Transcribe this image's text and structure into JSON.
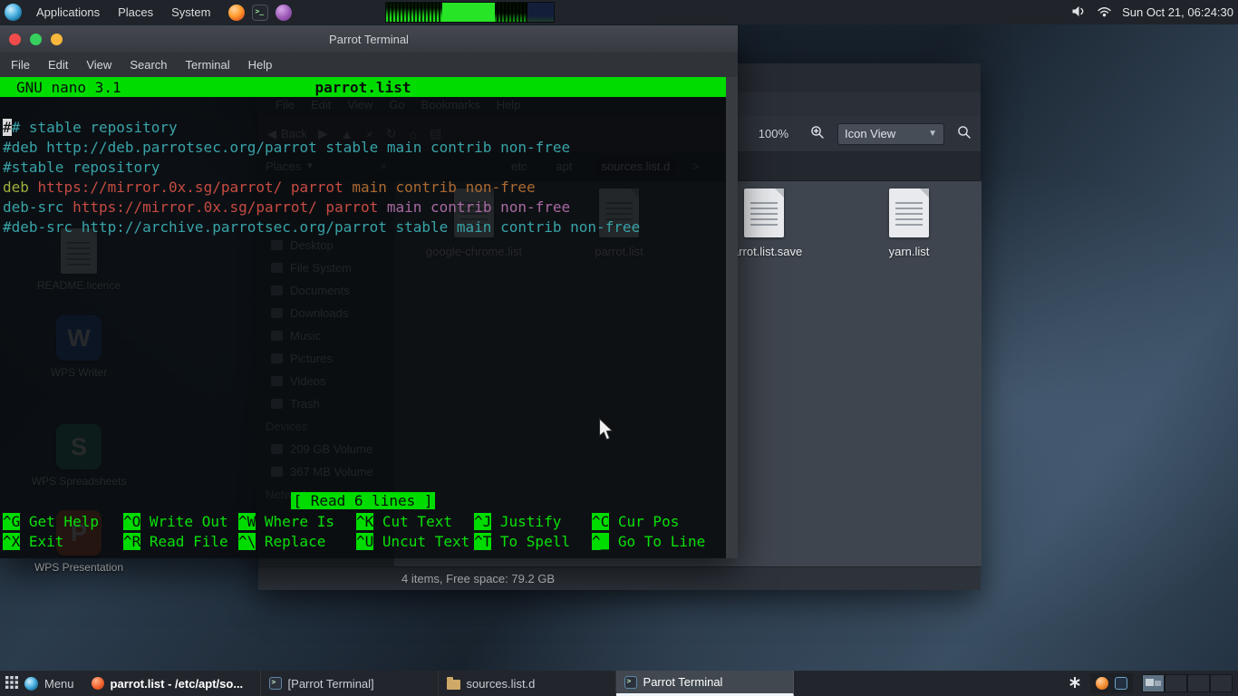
{
  "panel": {
    "menus": [
      "Applications",
      "Places",
      "System"
    ],
    "launchers": [
      "firefox-icon",
      "terminal-icon",
      "package-icon"
    ],
    "status_icons": [
      "volume-icon",
      "network-icon"
    ],
    "clock": "Sun Oct 21, 06:24:30"
  },
  "desktop": {
    "icons": [
      {
        "label": "README.licence",
        "kind": "document"
      },
      {
        "label": "WPS Writer",
        "kind": "app",
        "letter": "W",
        "color": "#3464c8"
      },
      {
        "label": "WPS Spreadsheets",
        "kind": "app",
        "letter": "S",
        "color": "#2e9a7a"
      },
      {
        "label": "WPS Presentation",
        "kind": "app",
        "letter": "P",
        "color": "#e2642f"
      }
    ]
  },
  "terminal": {
    "title": "Parrot Terminal",
    "menus": [
      "File",
      "Edit",
      "View",
      "Search",
      "Terminal",
      "Help"
    ],
    "nano": {
      "app_title": "GNU nano 3.1",
      "file_name": "parrot.list",
      "status_message": "[ Read 6 lines ]",
      "palette": {
        "comment": "#38a3a8",
        "keyword": "#9fae3c",
        "url": "#c74b42",
        "value": "#ab6a31",
        "alt": "#a869a3",
        "green": "#0ae00a"
      },
      "lines": [
        [
          {
            "t": "#",
            "cursor": true
          },
          {
            "t": "# stable repository",
            "c": "comment"
          }
        ],
        [
          {
            "t": "#deb http://deb.parrotsec.org/parrot stable main contrib non-free",
            "c": "comment"
          }
        ],
        [
          {
            "t": "#stable repository",
            "c": "comment"
          }
        ],
        [
          {
            "t": "deb",
            "c": "keyword"
          },
          {
            "t": " https://mirror.0x.sg/parrot/",
            "c": "url"
          },
          {
            "t": " parrot",
            "c": "url"
          },
          {
            "t": " main contrib non-free",
            "c": "value"
          }
        ],
        [
          {
            "t": "deb-src",
            "c": "comment"
          },
          {
            "t": " https://mirror.0x.sg/parrot/",
            "c": "url"
          },
          {
            "t": " parrot",
            "c": "url"
          },
          {
            "t": " main contrib non-free",
            "c": "alt"
          }
        ],
        [
          {
            "t": "#deb-src http://archive.parrotsec.org/parrot stable main contrib non-free",
            "c": "comment"
          }
        ]
      ],
      "shortcuts": [
        [
          {
            "key": "^G",
            "label": "Get Help"
          },
          {
            "key": "^O",
            "label": "Write Out"
          },
          {
            "key": "^W",
            "label": "Where Is"
          },
          {
            "key": "^K",
            "label": "Cut Text"
          },
          {
            "key": "^J",
            "label": "Justify"
          },
          {
            "key": "^C",
            "label": "Cur Pos"
          }
        ],
        [
          {
            "key": "^X",
            "label": "Exit"
          },
          {
            "key": "^R",
            "label": "Read File"
          },
          {
            "key": "^\\",
            "label": "Replace"
          },
          {
            "key": "^U",
            "label": "Uncut Text"
          },
          {
            "key": "^T",
            "label": "To Spell"
          },
          {
            "key": "^_",
            "label": "Go To Line"
          }
        ]
      ]
    }
  },
  "file_manager": {
    "menus": [
      "File",
      "Edit",
      "View",
      "Go",
      "Bookmarks",
      "Help"
    ],
    "toolbar": {
      "back_label": "Back",
      "nav_icons": [
        "forward-icon",
        "up-icon",
        "stop-icon",
        "reload-icon",
        "home-icon",
        "computer-icon"
      ],
      "zoom_level": "100%",
      "view_mode": "Icon View"
    },
    "places_header": "Places",
    "breadcrumbs": [
      {
        "label": "etc",
        "active": false
      },
      {
        "label": "apt",
        "active": false
      },
      {
        "label": "sources.list.d",
        "active": true
      }
    ],
    "sidebar": [
      {
        "label": "Desktop",
        "type": "item"
      },
      {
        "label": "File System",
        "type": "item"
      },
      {
        "label": "Documents",
        "type": "item"
      },
      {
        "label": "Downloads",
        "type": "item"
      },
      {
        "label": "Music",
        "type": "item"
      },
      {
        "label": "Pictures",
        "type": "item"
      },
      {
        "label": "Videos",
        "type": "item"
      },
      {
        "label": "Trash",
        "type": "item"
      },
      {
        "label": "Devices",
        "type": "header"
      },
      {
        "label": "209 GB Volume",
        "type": "item"
      },
      {
        "label": "367 MB Volume",
        "type": "item"
      },
      {
        "label": "Network",
        "type": "header"
      }
    ],
    "files": [
      {
        "name": "google-chrome.list"
      },
      {
        "name": "parrot.list"
      },
      {
        "name": "parrot.list.save"
      },
      {
        "name": "yarn.list"
      }
    ],
    "status": "4 items, Free space: 79.2 GB"
  },
  "taskbar": {
    "menu_label": "Menu",
    "tasks": [
      {
        "label": "parrot.list - /etc/apt/so...",
        "icon": "text-editor",
        "active": true,
        "highlighted": false
      },
      {
        "label": "[Parrot Terminal]",
        "icon": "terminal",
        "active": false,
        "highlighted": false
      },
      {
        "label": "sources.list.d",
        "icon": "folder",
        "active": false,
        "highlighted": false
      },
      {
        "label": "Parrot Terminal",
        "icon": "terminal",
        "active": false,
        "highlighted": true
      }
    ],
    "tray_icons": [
      "parrot-tray-icon",
      "terminal-tray-icon"
    ],
    "workspaces": {
      "count": 4,
      "active": 1
    }
  }
}
